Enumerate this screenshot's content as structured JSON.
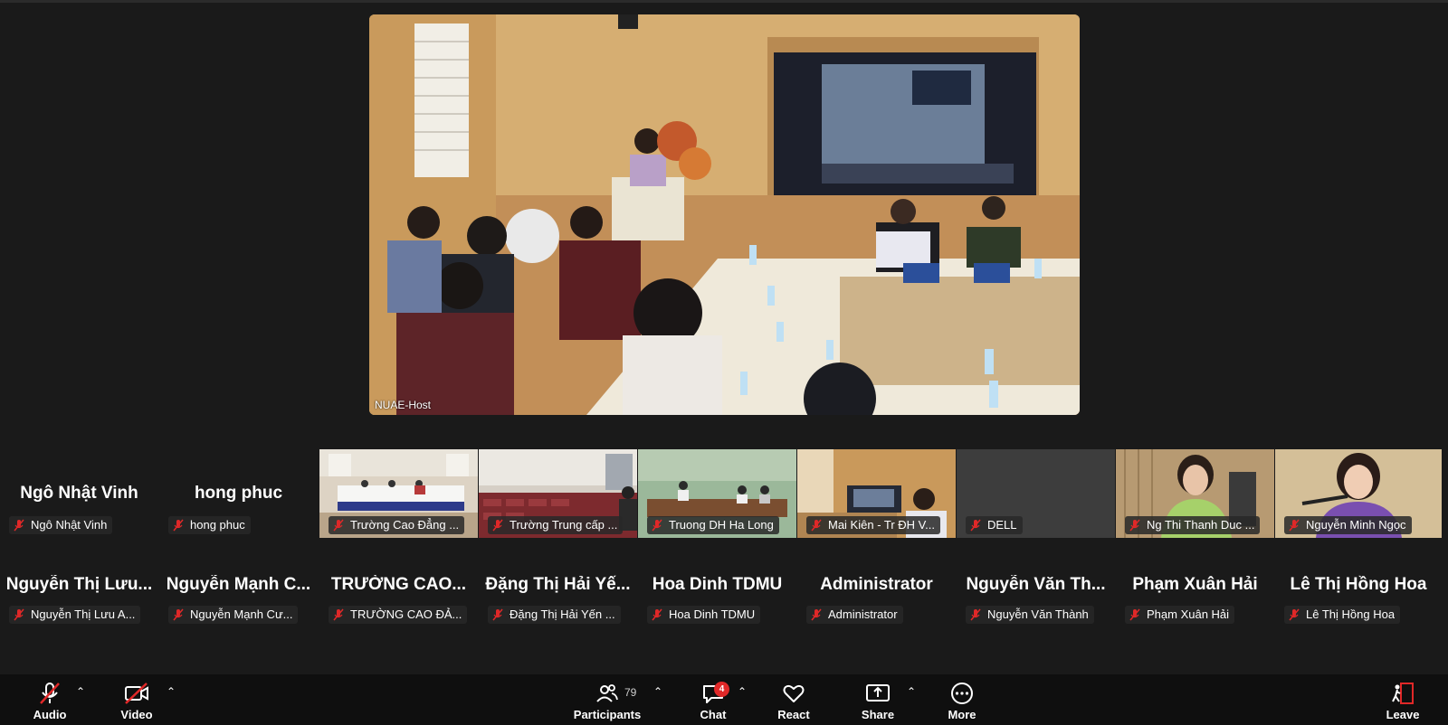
{
  "main_video": {
    "name": "NUAE-Host"
  },
  "gallery_row1": [
    {
      "display": "Ngô Nhật Vinh",
      "label": "Ngô Nhật Vinh",
      "video": false,
      "hand": true
    },
    {
      "display": "hong phuc",
      "label": "hong phuc",
      "video": false
    },
    {
      "label": "Trường Cao Đẳng ...",
      "video": true,
      "scene": "hall-white"
    },
    {
      "label": "Trường Trung cấp ...",
      "video": true,
      "scene": "hall-red"
    },
    {
      "label": "Truong DH Ha Long",
      "video": true,
      "scene": "room-green"
    },
    {
      "label": "Mai Kiên - Tr ĐH V...",
      "video": true,
      "scene": "room-orange"
    },
    {
      "label": "DELL",
      "video": true,
      "scene": "blank"
    },
    {
      "label": "Ng Thi Thanh Duc ...",
      "video": true,
      "scene": "woman-green"
    },
    {
      "label": "Nguyễn Minh Ngọc",
      "video": true,
      "scene": "woman-purple"
    }
  ],
  "gallery_row2": [
    {
      "display": "Nguyễn Thị Lưu...",
      "label": "Nguyễn Thị Lưu A..."
    },
    {
      "display": "Nguyễn Mạnh C...",
      "label": "Nguyễn Mạnh Cư..."
    },
    {
      "display": "TRƯỜNG CAO...",
      "label": "TRƯỜNG CAO ĐẢ..."
    },
    {
      "display": "Đặng Thị Hải Yế...",
      "label": "Đặng Thị Hải Yến ..."
    },
    {
      "display": "Hoa Dinh TDMU",
      "label": "Hoa Dinh TDMU"
    },
    {
      "display": "Administrator",
      "label": "Administrator"
    },
    {
      "display": "Nguyễn Văn Th...",
      "label": "Nguyễn Văn Thành"
    },
    {
      "display": "Phạm Xuân Hải",
      "label": "Phạm Xuân Hải"
    },
    {
      "display": "Lê Thị Hồng Hoa",
      "label": "Lê Thị Hồng Hoa"
    }
  ],
  "toolbar": {
    "audio": "Audio",
    "video": "Video",
    "participants": "Participants",
    "participants_count": "79",
    "chat": "Chat",
    "chat_badge": "4",
    "react": "React",
    "share": "Share",
    "more": "More",
    "leave": "Leave"
  },
  "colors": {
    "background": "#1a1a1a",
    "toolbar": "#0f0f0f",
    "badge": "#e02828",
    "leave": "#e02828",
    "muted_icon": "#e02828"
  }
}
